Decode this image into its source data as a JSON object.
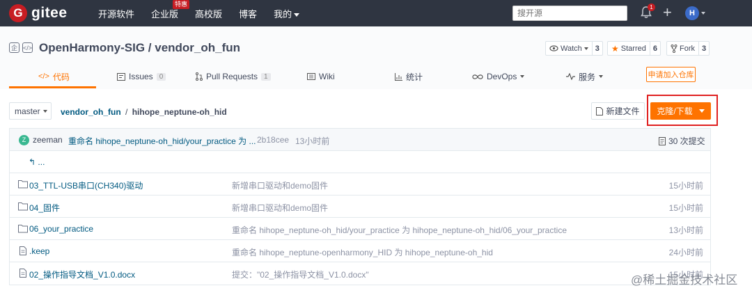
{
  "nav": {
    "brand": "gitee",
    "links": [
      "开源软件",
      "企业版",
      "高校版",
      "博客",
      "我的"
    ],
    "hot_badge": "特惠",
    "search_placeholder": "搜开源",
    "notification_count": "1",
    "avatar_letter": "H"
  },
  "repo": {
    "title": "OpenHarmony-SIG / vendor_oh_fun",
    "watch": {
      "label": "Watch",
      "count": "3"
    },
    "star": {
      "label": "Starred",
      "count": "6"
    },
    "fork": {
      "label": "Fork",
      "count": "3"
    }
  },
  "tabs": [
    {
      "label": "代码",
      "icon": "code-icon",
      "active": true
    },
    {
      "label": "Issues",
      "count": "0",
      "icon": "issues-icon"
    },
    {
      "label": "Pull Requests",
      "count": "1",
      "icon": "pull-request-icon"
    },
    {
      "label": "Wiki",
      "icon": "wiki-icon"
    },
    {
      "label": "统计",
      "icon": "stats-icon"
    },
    {
      "label": "DevOps",
      "icon": "devops-icon"
    },
    {
      "label": "服务",
      "icon": "service-icon"
    }
  ],
  "join_button": "申请加入仓库",
  "path": {
    "branch": "master",
    "repo": "vendor_oh_fun",
    "separator": "/",
    "folder": "hihope_neptune-oh_hid",
    "new_file": "新建文件",
    "clone": "克隆/下载"
  },
  "last_commit": {
    "avatar": "Z",
    "author": "zeeman",
    "message": "重命名 hihope_neptune-oh_hid/your_practice 为 ...",
    "sha": "2b18cee",
    "time": "13小时前",
    "commits": "30 次提交"
  },
  "back_link": "...",
  "files": [
    {
      "name": "03_TTL-USB串口(CH340)驱动",
      "type": "folder",
      "message": "新增串口驱动和demo固件",
      "time": "15小时前"
    },
    {
      "name": "04_固件",
      "type": "folder",
      "message": "新增串口驱动和demo固件",
      "time": "15小时前"
    },
    {
      "name": "06_your_practice",
      "type": "folder",
      "message": "重命名 hihope_neptune-oh_hid/your_practice 为 hihope_neptune-oh_hid/06_your_practice",
      "time": "13小时前"
    },
    {
      "name": ".keep",
      "type": "file",
      "message": "重命名 hihope_neptune-openharmony_HID 为 hihope_neptune-oh_hid",
      "time": "24小时前"
    },
    {
      "name": "02_操作指导文档_V1.0.docx",
      "type": "file",
      "message": "提交：\"02_操作指导文档_V1.0.docx\"",
      "time": "15小时前"
    }
  ],
  "watermark": "@稀土掘金技术社区",
  "colors": {
    "accent": "#fe7300",
    "nav_bg": "#2f3541",
    "brand_red": "#c71d23",
    "link": "#005980"
  }
}
